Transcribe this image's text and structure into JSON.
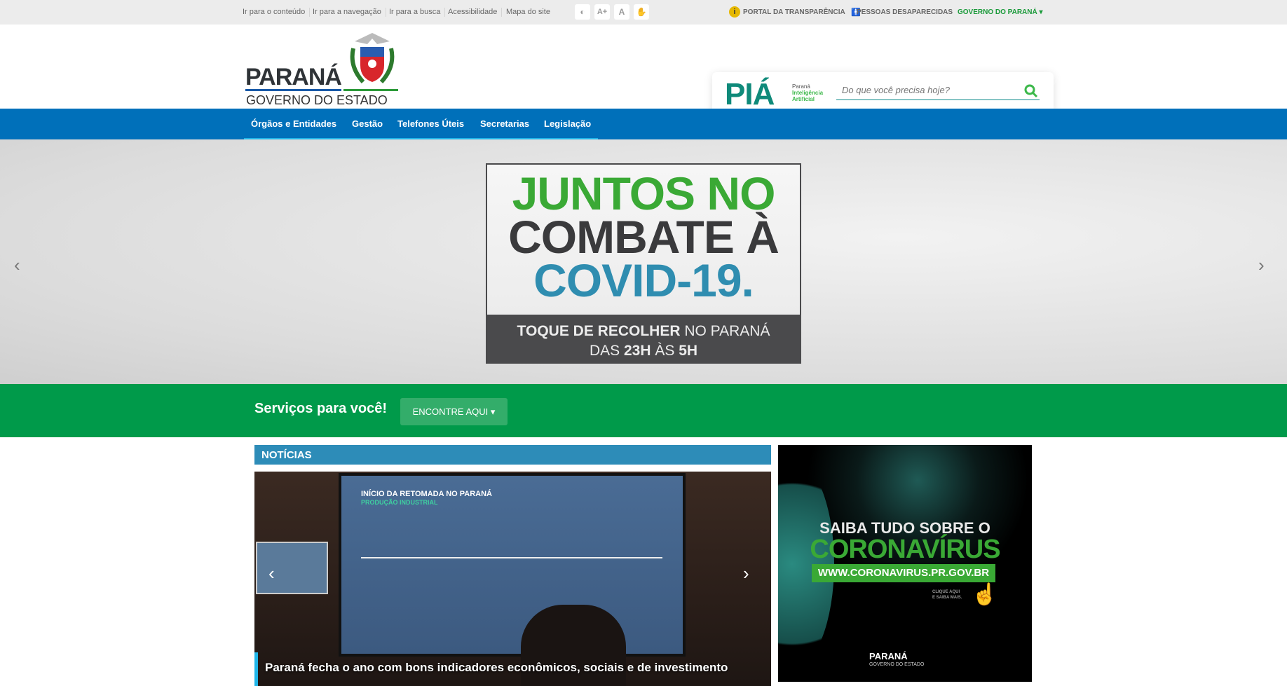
{
  "topbar": {
    "skip_links": [
      "Ir para o conteúdo",
      "Ir para a navegação",
      "Ir para a busca",
      "Acessibilidade",
      "Mapa do site"
    ],
    "accessibility": {
      "contrast": "◐",
      "increase": "A+",
      "default": "A",
      "libras": "✋"
    },
    "transparency": "PORTAL DA TRANSPARÊNCIA",
    "missing": "PESSOAS DESAPARECIDAS",
    "gov": "GOVERNO DO PARANÁ"
  },
  "logo": {
    "title": "PARANÁ",
    "subtitle": "GOVERNO DO ESTADO"
  },
  "search": {
    "brand": "PIÁ",
    "brand_line1": "Paraná",
    "brand_line2": "Inteligência",
    "brand_line3": "Artificial",
    "placeholder": "Do que você precisa hoje?"
  },
  "nav": [
    "Órgãos e Entidades",
    "Gestão",
    "Telefones Úteis",
    "Secretarias",
    "Legislação"
  ],
  "hero": {
    "line1": "JUNTOS NO",
    "line2": "COMBATE À",
    "line3": "COVID-19.",
    "sub_bold": "TOQUE DE RECOLHER",
    "sub_rest": " NO PARANÁ",
    "sub2_a": "DAS ",
    "sub2_b": "23H",
    "sub2_c": " ÀS ",
    "sub2_d": "5H"
  },
  "services": {
    "title": "Serviços para você!",
    "button": "ENCONTRE AQUI"
  },
  "news": {
    "header": "NOTÍCIAS",
    "caption": "Paraná fecha o ano com bons indicadores econômicos, sociais e de investimento",
    "screen_title": "INÍCIO DA RETOMADA NO PARANÁ",
    "screen_sub": "PRODUÇÃO INDUSTRIAL"
  },
  "promo": {
    "line1": "SAIBA TUDO SOBRE O",
    "line2": "CORONAVÍRUS",
    "url": "WWW.CORONAVIRUS.PR.GOV.BR",
    "cta1": "CLIQUE AQUI",
    "cta2": "E SAIBA MAIS.",
    "logo1": "PARANÁ",
    "logo2": "GOVERNO DO ESTADO"
  },
  "colors": {
    "nav": "#0070ba",
    "green": "#009a4a",
    "news": "#2d8cb8"
  }
}
